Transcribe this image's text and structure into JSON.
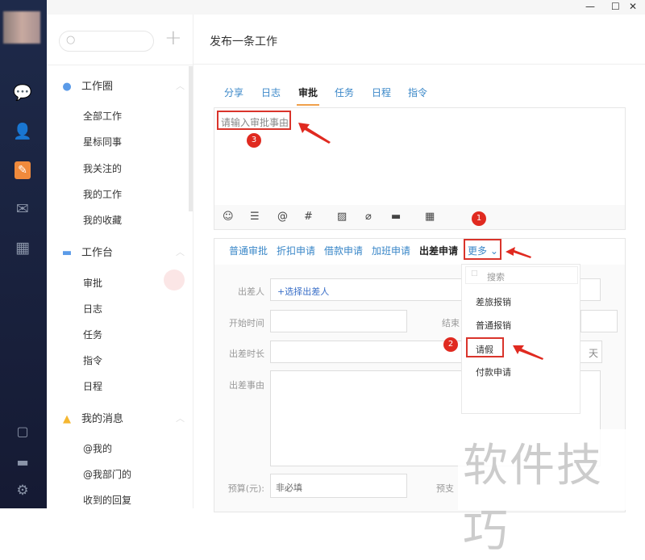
{
  "window": {
    "controls": [
      "—",
      "☐",
      "✕"
    ]
  },
  "rail": {
    "icons": [
      "chat-icon",
      "contacts-icon",
      "work-icon",
      "mail-icon",
      "calendar-icon",
      "window-icon",
      "drive-icon",
      "settings-icon"
    ]
  },
  "sidebar": {
    "groups": [
      {
        "label": "工作圈",
        "items": [
          "全部工作",
          "星标同事",
          "我关注的",
          "我的工作",
          "我的收藏"
        ]
      },
      {
        "label": "工作台",
        "items": [
          "审批",
          "日志",
          "任务",
          "指令",
          "日程"
        ]
      },
      {
        "label": "我的消息",
        "items": [
          "@我的",
          "@我部门的",
          "收到的回复"
        ]
      }
    ]
  },
  "header": {
    "title": "发布一条工作"
  },
  "tabs": [
    "分享",
    "日志",
    "审批",
    "任务",
    "日程",
    "指令"
  ],
  "editor": {
    "placeholder": "请输入审批事由"
  },
  "subtabs": [
    "普通审批",
    "折扣申请",
    "借款申请",
    "加班申请",
    "出差申请",
    "更多"
  ],
  "form": {
    "traveler_label": "出差人",
    "traveler_link": "+选择出差人",
    "start_label": "开始时间",
    "end_label": "结束",
    "duration_label": "出差时长",
    "duration_unit": "天",
    "reason_label": "出差事由",
    "budget_label": "预算(元):",
    "budget_placeholder": "非必填",
    "advance_label": "预支"
  },
  "dropdown": {
    "search_placeholder": "搜索",
    "items": [
      "差旅报销",
      "普通报销",
      "请假",
      "付款申请"
    ]
  },
  "annotations": {
    "b1": "1",
    "b2": "2",
    "b3": "3",
    "accent": "#d9342b"
  },
  "watermark": "软件技巧"
}
